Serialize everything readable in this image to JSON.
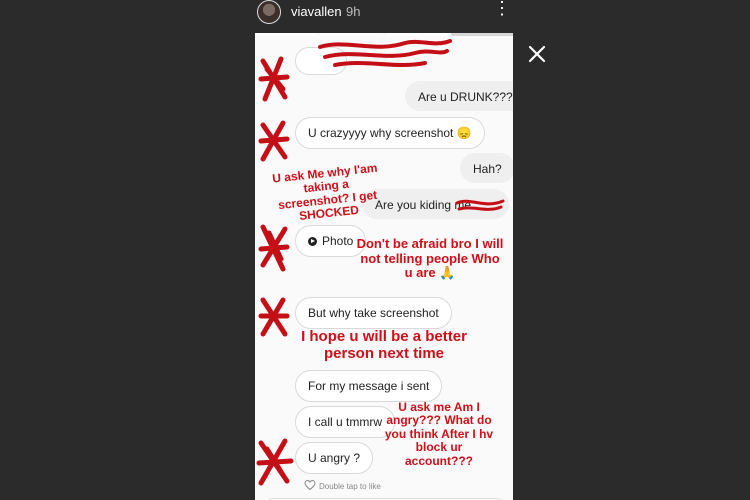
{
  "header": {
    "username": "viavallen",
    "time": "9h",
    "more_icon": "⋮",
    "close_icon": "close-icon"
  },
  "messages": [
    {
      "side": "right",
      "text": "Are u DRUNK???"
    },
    {
      "side": "left",
      "text": "U crazyyyy why screenshot 😞"
    },
    {
      "side": "right",
      "text": "Hah?"
    },
    {
      "side": "right",
      "text": "Are you kiding me"
    },
    {
      "side": "left",
      "text": "Photo",
      "icon": "play-icon"
    },
    {
      "side": "left",
      "text": "But why take screenshot"
    },
    {
      "side": "left",
      "text": "For my message i sent"
    },
    {
      "side": "left",
      "text": "I call u tmmrw"
    },
    {
      "side": "left",
      "text": "U angry ?"
    }
  ],
  "notes": {
    "n1": "U ask Me why I'am taking a screenshot? I get SHOCKED",
    "n2": "Don't be afraid bro I will not telling people Who u are 🙏",
    "n3": "I hope u will be a better person next time",
    "n4": "U ask me Am I angry??? What do you think After I hv block ur account???"
  },
  "footer": {
    "double_tap": "Double tap to like"
  },
  "colors": {
    "annotation_red": "#d10f18",
    "background": "#2b2b2b"
  }
}
